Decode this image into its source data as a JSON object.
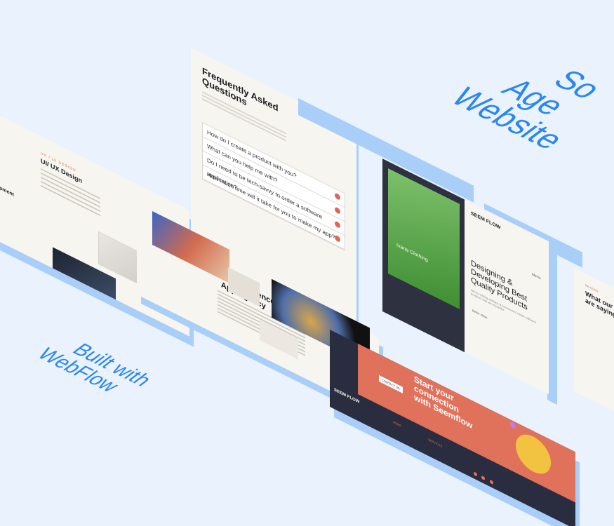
{
  "headline_right": [
    "So",
    "Age",
    "Website"
  ],
  "headline_left": [
    "Built with",
    "WebFlow"
  ],
  "faq": {
    "title_line1": "Frequently Asked",
    "title_line2": "Questions",
    "questions": [
      "How do I create a product with you?",
      "What can you help me with?",
      "Do I need to be tech-savvy to order a software application?",
      "How much time will it take for you to make my app?"
    ]
  },
  "ux_card": {
    "eyebrow": "UX / UI DESIGN",
    "title": "UI/ UX Design",
    "side_label": "Development"
  },
  "agency_card": {
    "eyebrow": "ABOUT",
    "title_line1": "An Experienced",
    "title_line2": "App Agency"
  },
  "seemflow_card": {
    "logo": "SEEM FLOW",
    "nav": "Menu",
    "headline": [
      "Designing &",
      "Developing Best",
      "Quality Products"
    ],
    "sub": "We're helping startups & businesses create software products that are impactful.",
    "cta": "Better ideas",
    "phone_label": "Ivana Clothing"
  },
  "reviews_card": {
    "eyebrow": "REVIEWS",
    "title_line1": "What our",
    "title_line2": "are saying"
  },
  "contact_card": {
    "title": [
      "Start your",
      "connection",
      "with Seemflow"
    ],
    "button": "CONTACT US",
    "footer_logo": "SEEM FLOW",
    "footer_links": [
      "HOME",
      "SERVICES"
    ]
  },
  "colors": {
    "accent_blue": "#2b86ee",
    "coral": "#e0715b",
    "navy": "#2a2c3f",
    "green": "#4a9e3b",
    "cream": "#f7f5f0"
  }
}
